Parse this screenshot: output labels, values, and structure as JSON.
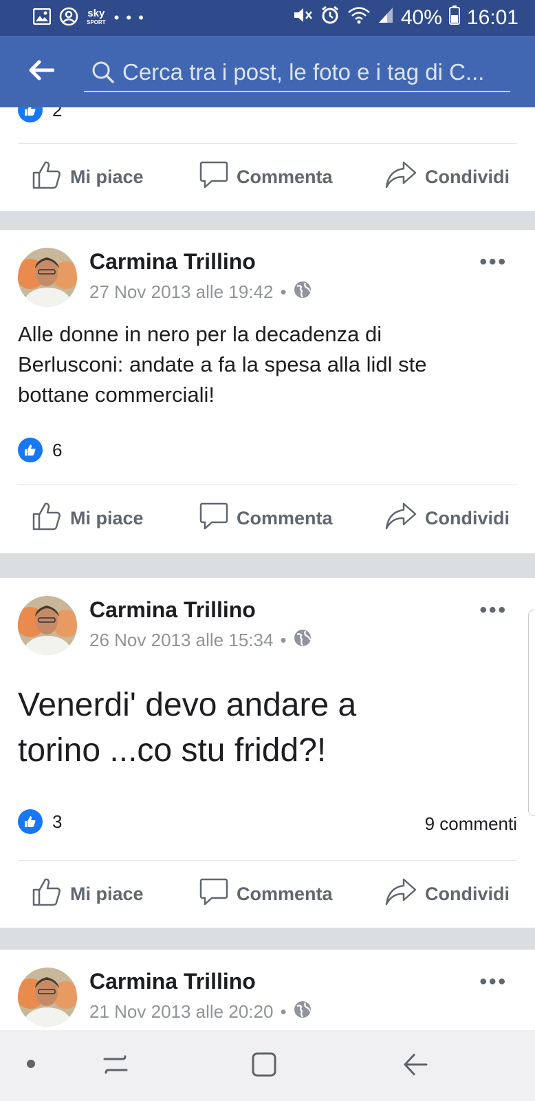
{
  "status_bar": {
    "sky_label": "sky",
    "sky_sub": "SPORT",
    "dots": "• • •",
    "battery": "40%",
    "time": "16:01"
  },
  "search": {
    "placeholder": "Cerca tra i post, le foto e i tag di C..."
  },
  "actions": {
    "like": "Mi piace",
    "comment": "Commenta",
    "share": "Condividi"
  },
  "top_fragment": {
    "likes": "2"
  },
  "posts": [
    {
      "author": "Carmina Trillino",
      "date": "27 Nov 2013 alle 19:42",
      "text_lines": [
        "Alle donne in nero per la decadenza di",
        "Berlusconi: andate a fa la spesa alla lidl ste",
        "bottane commerciali!"
      ],
      "likes": "6"
    },
    {
      "author": "Carmina Trillino",
      "date": "26 Nov 2013 alle 15:34",
      "text_lines": [
        "Venerdi' devo andare a",
        "torino ...co stu fridd?!"
      ],
      "likes": "3",
      "comments": "9 commenti"
    },
    {
      "author": "Carmina Trillino",
      "date": "21 Nov 2013 alle 20:20"
    }
  ],
  "colors": {
    "status_bar": "#2f4b8c",
    "app_bar": "#4267b2",
    "like_blue": "#1877f2",
    "feed_bg": "#dadde1"
  }
}
